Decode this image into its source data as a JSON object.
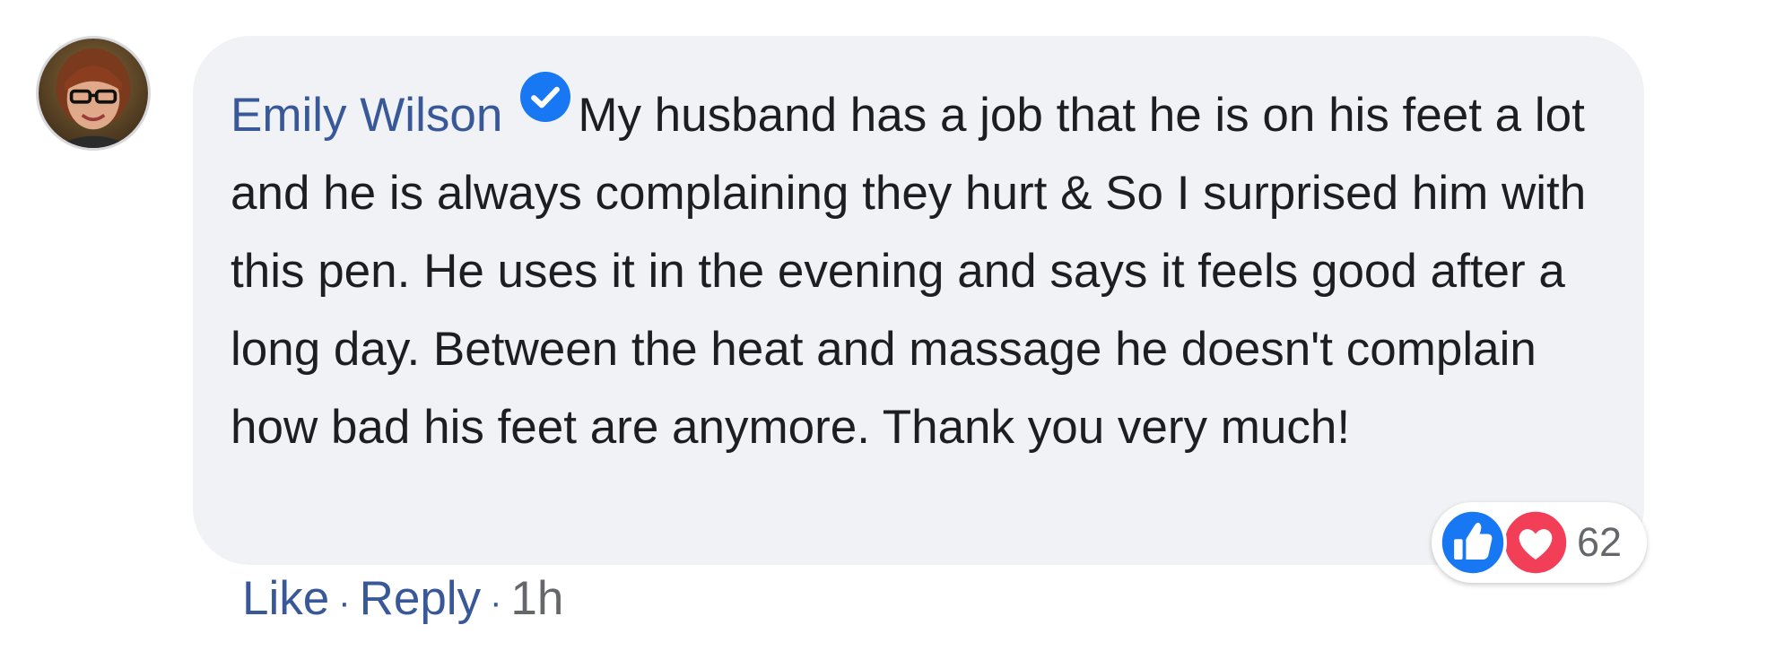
{
  "comment": {
    "author": "Emily Wilson",
    "verified": true,
    "text": "My husband has a job that he is on his feet a lot and he is always complaining they hurt & So I surprised him with this pen. He uses it in the evening and says it feels good after a long day. Between the heat and massage he doesn't complain how bad his feet are anymore. Thank you very much!"
  },
  "reactions": {
    "icons": [
      "like-icon",
      "love-icon"
    ],
    "count": "62"
  },
  "actions": {
    "like_label": "Like",
    "reply_label": "Reply",
    "separator": "·",
    "timestamp": "1h"
  },
  "colors": {
    "link": "#385898",
    "bubble_bg": "#f0f2f5",
    "text": "#1c1e21",
    "meta": "#65676b",
    "like_blue": "#1877f2",
    "love_red": "#f33e58"
  }
}
